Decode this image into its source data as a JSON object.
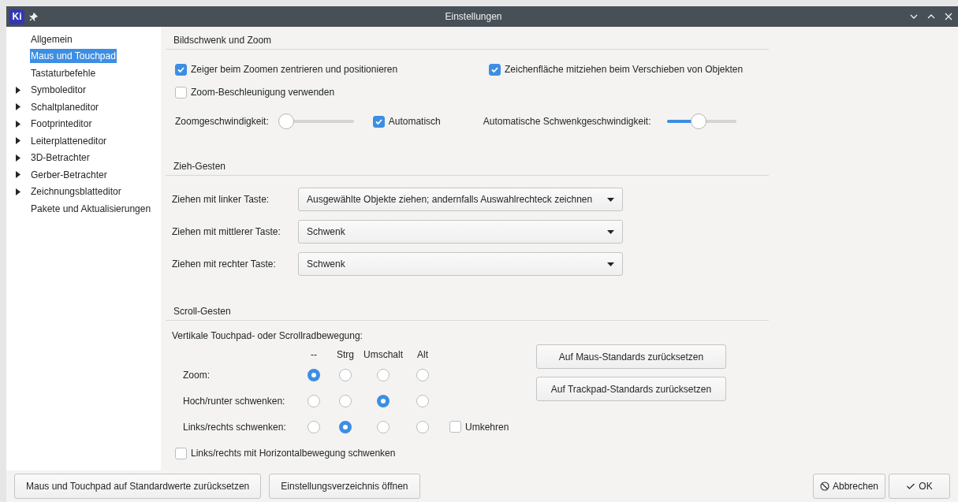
{
  "window": {
    "app_icon_text": "Ki",
    "title": "Einstellungen"
  },
  "sidebar": {
    "items": [
      {
        "label": "Allgemein",
        "expandable": false,
        "selected": false
      },
      {
        "label": "Maus und Touchpad",
        "expandable": false,
        "selected": true
      },
      {
        "label": "Tastaturbefehle",
        "expandable": false,
        "selected": false
      },
      {
        "label": "Symboleditor",
        "expandable": true,
        "selected": false
      },
      {
        "label": "Schaltplaneditor",
        "expandable": true,
        "selected": false
      },
      {
        "label": "Footprinteditor",
        "expandable": true,
        "selected": false
      },
      {
        "label": "Leiterplatteneditor",
        "expandable": true,
        "selected": false
      },
      {
        "label": "3D-Betrachter",
        "expandable": true,
        "selected": false
      },
      {
        "label": "Gerber-Betrachter",
        "expandable": true,
        "selected": false
      },
      {
        "label": "Zeichnungsblatteditor",
        "expandable": true,
        "selected": false
      },
      {
        "label": "Pakete und Aktualisierungen",
        "expandable": false,
        "selected": false
      }
    ]
  },
  "pan_zoom": {
    "heading": "Bildschwenk und Zoom",
    "center_cursor": {
      "label": "Zeiger beim Zoomen zentrieren und positionieren",
      "checked": true
    },
    "auto_pan": {
      "label": "Zeichenfläche mitziehen beim Verschieben von Objekten",
      "checked": true
    },
    "zoom_acceleration": {
      "label": "Zoom-Beschleunigung verwenden",
      "checked": false
    },
    "zoom_speed": {
      "label": "Zoomgeschwindigkeit:",
      "level": 0
    },
    "automatic": {
      "label": "Automatisch",
      "checked": true
    },
    "auto_pan_speed": {
      "label": "Automatische Schwenkgeschwindigkeit:",
      "level": 0.45
    }
  },
  "drag_gestures": {
    "heading": "Zieh-Gesten",
    "rows": [
      {
        "label": "Ziehen mit linker Taste:",
        "value": "Ausgewählte Objekte ziehen; andernfalls Auswahlrechteck zeichnen"
      },
      {
        "label": "Ziehen mit mittlerer Taste:",
        "value": "Schwenk"
      },
      {
        "label": "Ziehen mit rechter Taste:",
        "value": "Schwenk"
      }
    ]
  },
  "scroll_gestures": {
    "heading": "Scroll-Gesten",
    "caption": "Vertikale Touchpad- oder Scrollradbewegung:",
    "columns": [
      "--",
      "Strg",
      "Umschalt",
      "Alt"
    ],
    "rows": [
      {
        "label": "Zoom:",
        "options": [
          {
            "selected": true
          },
          {
            "selected": false
          },
          {
            "selected": false
          },
          {
            "selected": false
          }
        ]
      },
      {
        "label": "Hoch/runter schwenken:",
        "options": [
          {
            "selected": false
          },
          {
            "selected": false
          },
          {
            "selected": true
          },
          {
            "selected": false
          }
        ]
      },
      {
        "label": "Links/rechts schwenken:",
        "options": [
          {
            "selected": false
          },
          {
            "selected": true
          },
          {
            "selected": false
          },
          {
            "selected": false
          }
        ],
        "invert": {
          "label": "Umkehren",
          "checked": false
        }
      }
    ],
    "horizontal": {
      "label": "Links/rechts mit Horizontalbewegung schwenken",
      "checked": false
    },
    "buttons": [
      "Auf Maus-Standards zurücksetzen",
      "Auf Trackpad-Standards zurücksetzen"
    ]
  },
  "footer": {
    "left_buttons": [
      "Maus und Touchpad auf Standardwerte zurücksetzen",
      "Einstellungsverzeichnis öffnen"
    ],
    "right_buttons": [
      {
        "label": "Abbrechen",
        "kind": "cancel"
      },
      {
        "label": "OK",
        "kind": "ok"
      }
    ]
  }
}
